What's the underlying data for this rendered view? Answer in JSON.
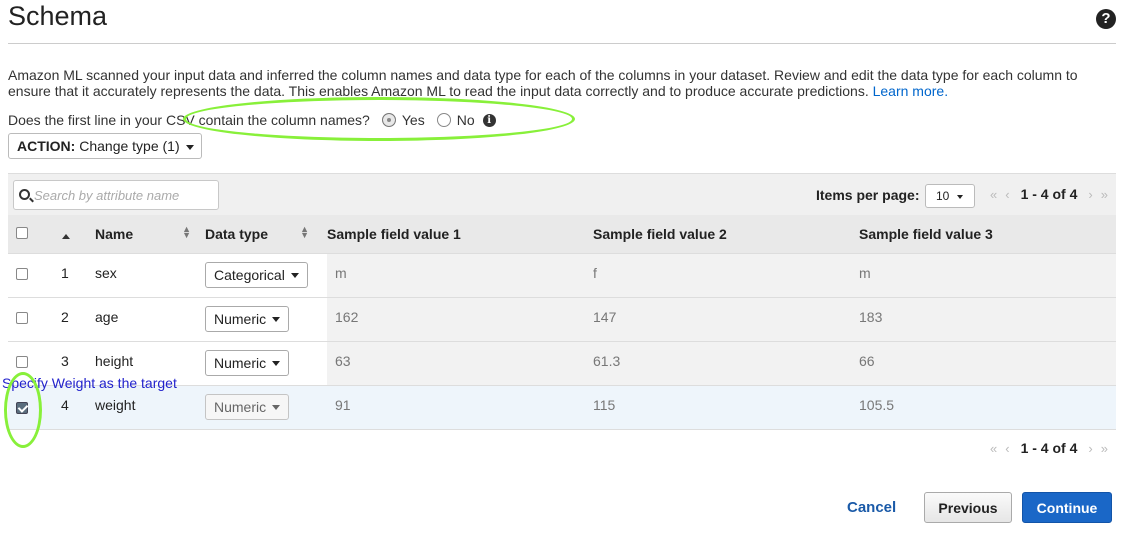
{
  "page": {
    "title": "Schema",
    "help_icon": "question-circle-icon"
  },
  "intro": {
    "text": "Amazon ML scanned your input data and inferred the column names and data type for each of the columns in your dataset. Review and edit the data type for each column to ensure that it accurately represents the data. This enables Amazon ML to read the input data correctly and to produce accurate predictions. ",
    "link": "Learn more."
  },
  "csv_question": {
    "label": "Does the first line in your CSV contain the column names?",
    "yes_label": "Yes",
    "no_label": "No",
    "selected": "Yes",
    "info_icon": "info-circle-icon"
  },
  "action": {
    "label_bold": "ACTION:",
    "label_rest": "Change type (1)"
  },
  "toolbar": {
    "search_placeholder": "Search by attribute name",
    "items_per_page_label": "Items per page:",
    "items_per_page_value": "10",
    "range": "1 - 4 of 4"
  },
  "table": {
    "headers": {
      "name": "Name",
      "data_type": "Data type",
      "sample1": "Sample field value 1",
      "sample2": "Sample field value 2",
      "sample3": "Sample field value 3"
    },
    "rows": [
      {
        "index": "1",
        "name": "sex",
        "type": "Categorical",
        "s1": "m",
        "s2": "f",
        "s3": "m",
        "checked": false
      },
      {
        "index": "2",
        "name": "age",
        "type": "Numeric",
        "s1": "162",
        "s2": "147",
        "s3": "183",
        "checked": false
      },
      {
        "index": "3",
        "name": "height",
        "type": "Numeric",
        "s1": "63",
        "s2": "61.3",
        "s3": "66",
        "checked": false
      },
      {
        "index": "4",
        "name": "weight",
        "type": "Numeric",
        "s1": "91",
        "s2": "115",
        "s3": "105.5",
        "checked": true
      }
    ]
  },
  "annotation": {
    "text": "Specify Weight as the target",
    "highlight_color": "#88f03a",
    "text_color": "#2222cc"
  },
  "footer": {
    "range": "1 - 4 of 4",
    "cancel": "Cancel",
    "previous": "Previous",
    "continue": "Continue"
  },
  "colors": {
    "primary": "#1a67c7",
    "link": "#0066cc"
  }
}
